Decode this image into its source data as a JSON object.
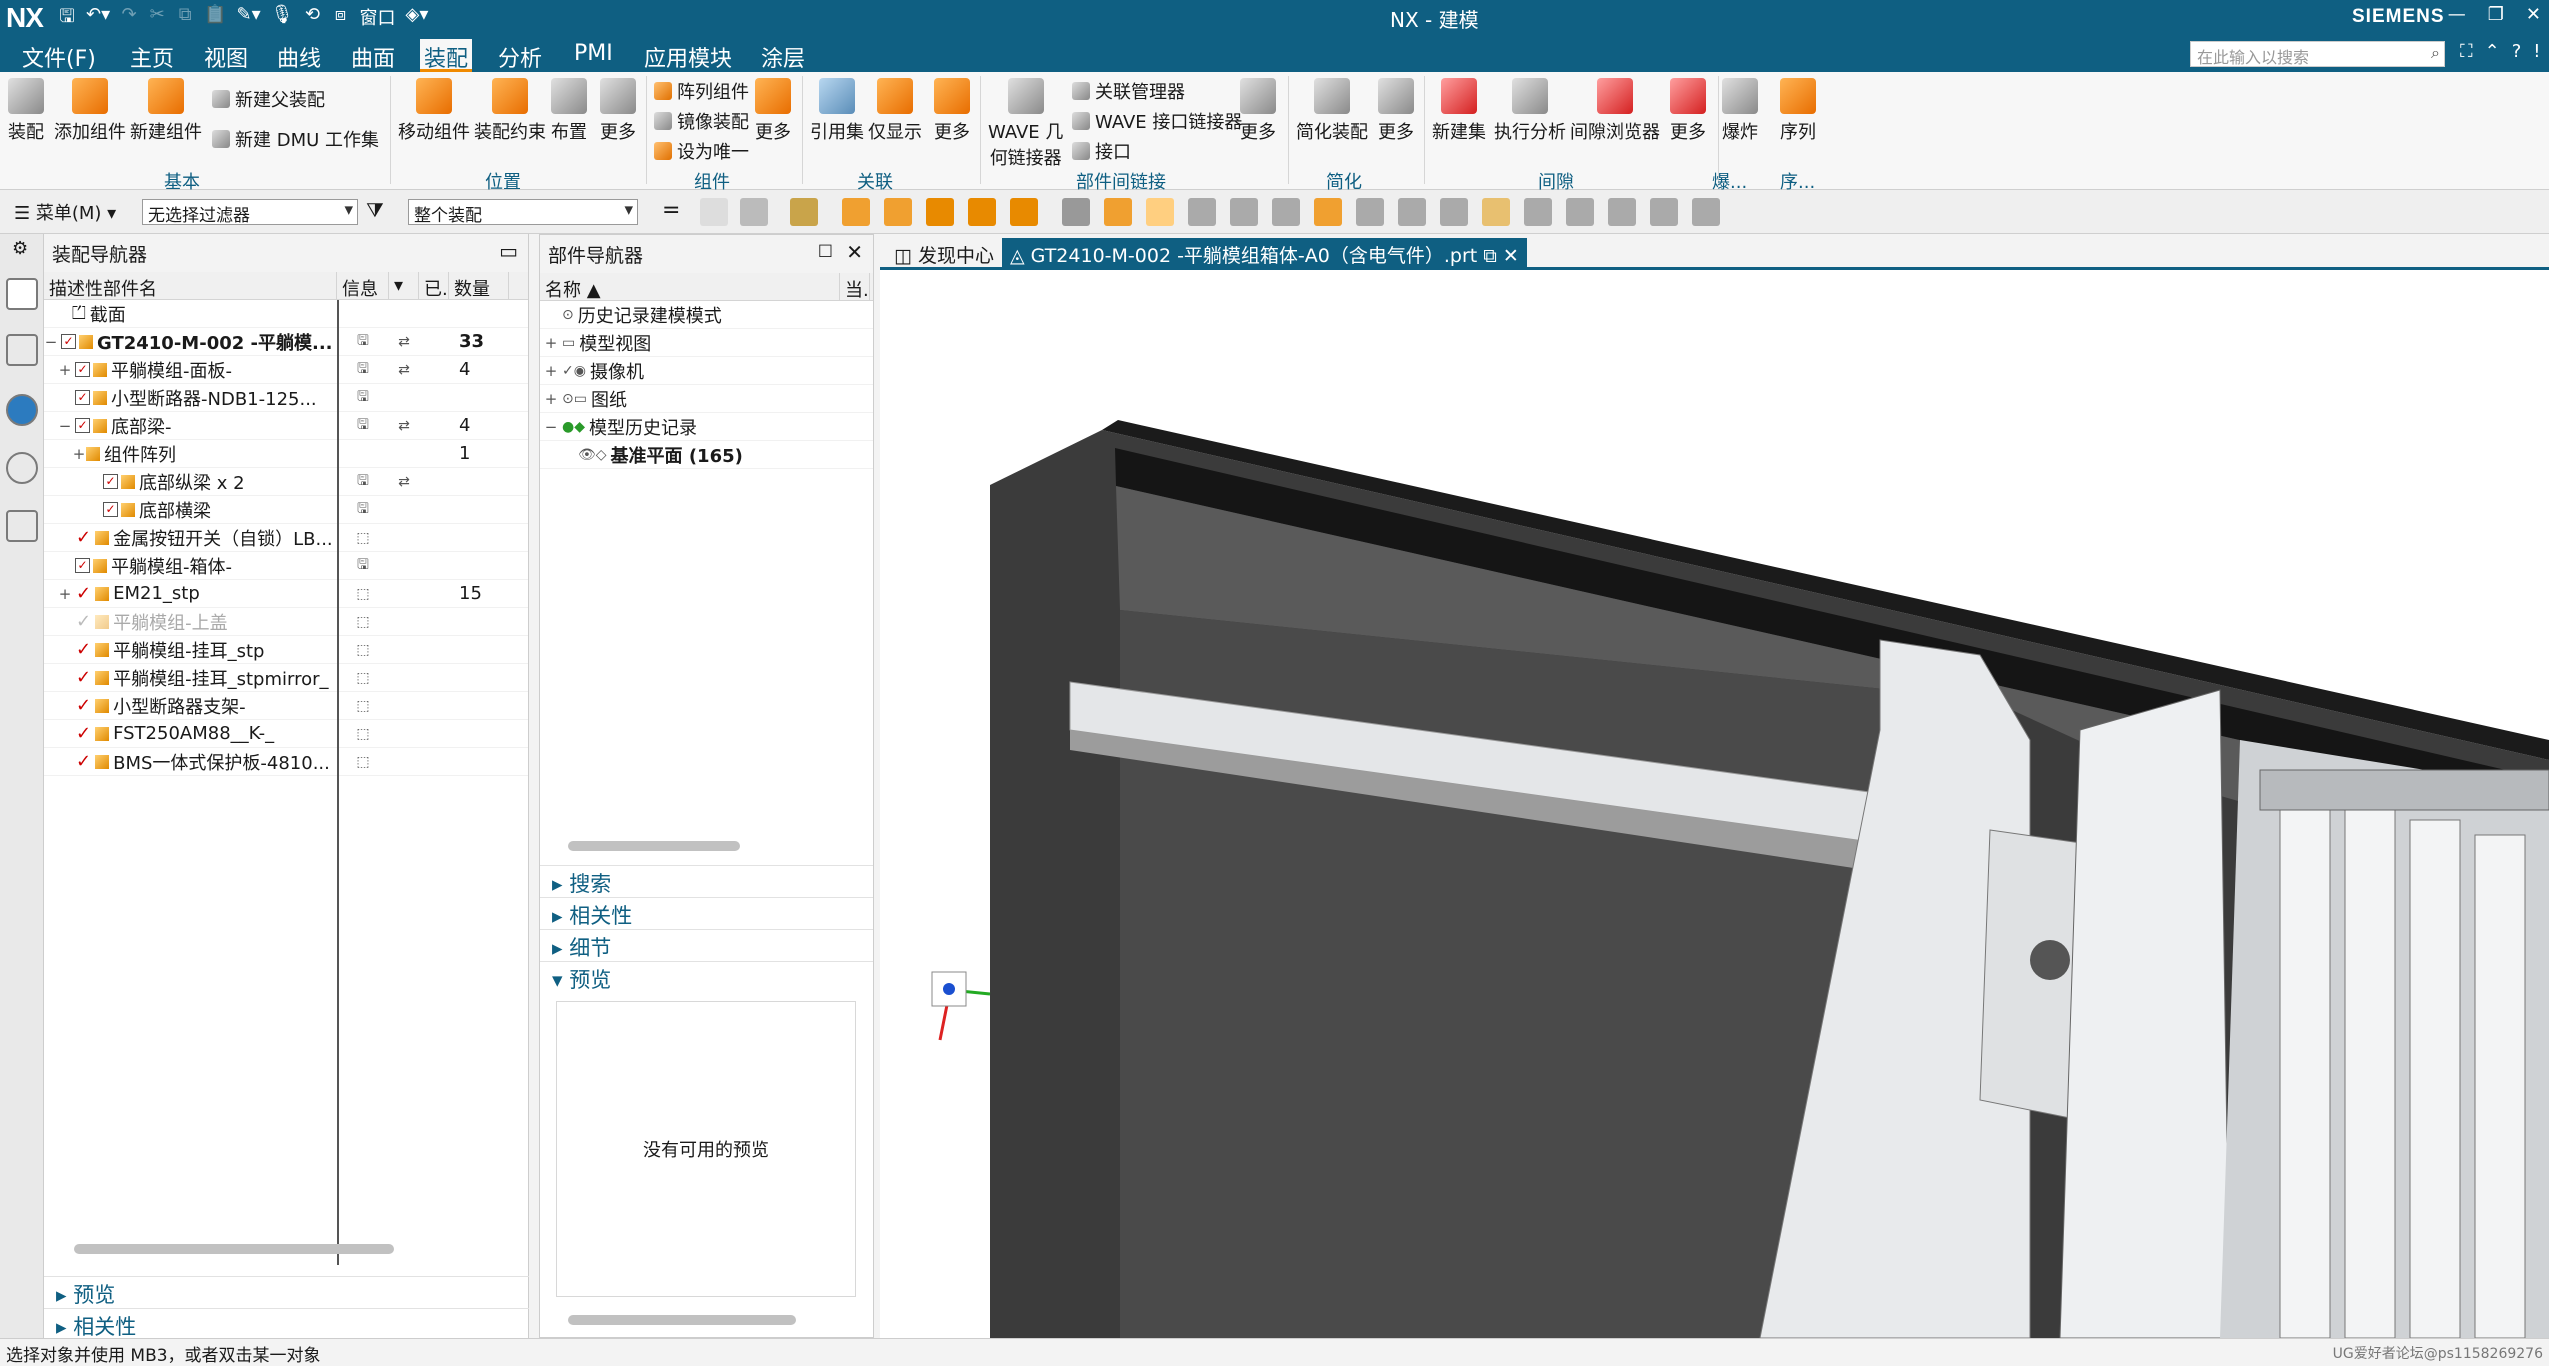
{
  "app": {
    "logo": "NX",
    "title": "NX - 建模",
    "brand": "SIEMENS",
    "window_label": "窗口"
  },
  "menu": {
    "file": "文件(F)",
    "items": [
      "主页",
      "视图",
      "曲线",
      "曲面",
      "装配",
      "分析",
      "PMI",
      "应用模块",
      "涂层"
    ],
    "active": "装配",
    "search_placeholder": "在此输入以搜索"
  },
  "ribbon": {
    "basic": {
      "buttons": [
        "装配",
        "添加组件",
        "新建组件"
      ],
      "small": [
        "新建父装配",
        "新建 DMU 工作集"
      ],
      "group": "基本"
    },
    "position": {
      "buttons": [
        "移动组件",
        "装配约束",
        "布置",
        "更多"
      ],
      "group": "位置"
    },
    "component": {
      "small": [
        "阵列组件",
        "镜像装配",
        "设为唯一"
      ],
      "more": "更多",
      "group": "组件"
    },
    "assoc": {
      "buttons": [
        "引用集",
        "仅显示",
        "更多"
      ],
      "group": "关联"
    },
    "interpart": {
      "wave_line1": "WAVE 几",
      "wave_line2": "何链接器",
      "small": [
        "关联管理器",
        "WAVE 接口链接器",
        "接口"
      ],
      "more": "更多",
      "group": "部件间链接"
    },
    "simplify": {
      "buttons": [
        "简化装配",
        "更多"
      ],
      "group": "简化"
    },
    "clearance": {
      "buttons": [
        "新建集",
        "执行分析",
        "间隙浏览器",
        "更多"
      ],
      "group": "间隙"
    },
    "explode": {
      "buttons": [
        "爆炸",
        "序列"
      ],
      "group1": "爆...",
      "group2": "序..."
    }
  },
  "toolbar2": {
    "menu_label": "菜单(M)",
    "filter": "无选择过滤器",
    "scope": "整个装配"
  },
  "asm_nav": {
    "title": "装配导航器",
    "columns": [
      "描述性部件名",
      "信息",
      "",
      "已...",
      "数量"
    ],
    "rows": [
      {
        "name": "截面",
        "qty": "",
        "tree": "",
        "type": "section"
      },
      {
        "name": "GT2410-M-002 -平躺模...",
        "qty": "33",
        "tree": "−",
        "type": "root"
      },
      {
        "name": "平躺模组-面板-",
        "qty": "4",
        "tree": "+",
        "type": "chk"
      },
      {
        "name": "小型断路器-NDB1-125...",
        "qty": "",
        "tree": "",
        "type": "chk"
      },
      {
        "name": "底部梁-",
        "qty": "4",
        "tree": "−",
        "type": "chk"
      },
      {
        "name": "组件阵列",
        "qty": "1",
        "tree": "+",
        "type": "arr"
      },
      {
        "name": "底部纵梁 x 2",
        "qty": "",
        "tree": "",
        "type": "chk2"
      },
      {
        "name": "底部横梁",
        "qty": "",
        "tree": "",
        "type": "chk2"
      },
      {
        "name": "金属按钮开关（自锁）LB...",
        "qty": "",
        "tree": "",
        "type": "red"
      },
      {
        "name": "平躺模组-箱体-",
        "qty": "",
        "tree": "",
        "type": "chk"
      },
      {
        "name": "EM21_stp",
        "qty": "15",
        "tree": "+",
        "type": "red"
      },
      {
        "name": "平躺模组-上盖",
        "qty": "",
        "tree": "",
        "type": "grey"
      },
      {
        "name": "平躺模组-挂耳_stp",
        "qty": "",
        "tree": "",
        "type": "red"
      },
      {
        "name": "平躺模组-挂耳_stpmirror_",
        "qty": "",
        "tree": "",
        "type": "red"
      },
      {
        "name": "小型断路器支架-",
        "qty": "",
        "tree": "",
        "type": "red"
      },
      {
        "name": "FST250AM88__K-_",
        "qty": "",
        "tree": "",
        "type": "red"
      },
      {
        "name": "BMS一体式保护板-4810...",
        "qty": "",
        "tree": "",
        "type": "red"
      }
    ],
    "sections": [
      "预览",
      "相关性"
    ]
  },
  "part_nav": {
    "title": "部件导航器",
    "columns": [
      "名称",
      "当."
    ],
    "rows": [
      {
        "name": "历史记录建模模式",
        "tree": ""
      },
      {
        "name": "模型视图",
        "tree": "+"
      },
      {
        "name": "摄像机",
        "tree": "+"
      },
      {
        "name": "图纸",
        "tree": "+"
      },
      {
        "name": "模型历史记录",
        "tree": "−"
      },
      {
        "name": "基准平面 (165)",
        "tree": ""
      }
    ],
    "sections": [
      "搜索",
      "相关性",
      "细节",
      "预览"
    ],
    "preview_text": "没有可用的预览"
  },
  "viewport": {
    "tabs": [
      "发现中心",
      "GT2410-M-002 -平躺模组箱体-A0（含电气件）.prt"
    ]
  },
  "status": {
    "text": "选择对象并使用 MB3，或者双击某一对象",
    "watermark": "UG爱好者论坛@ps1158269276"
  }
}
